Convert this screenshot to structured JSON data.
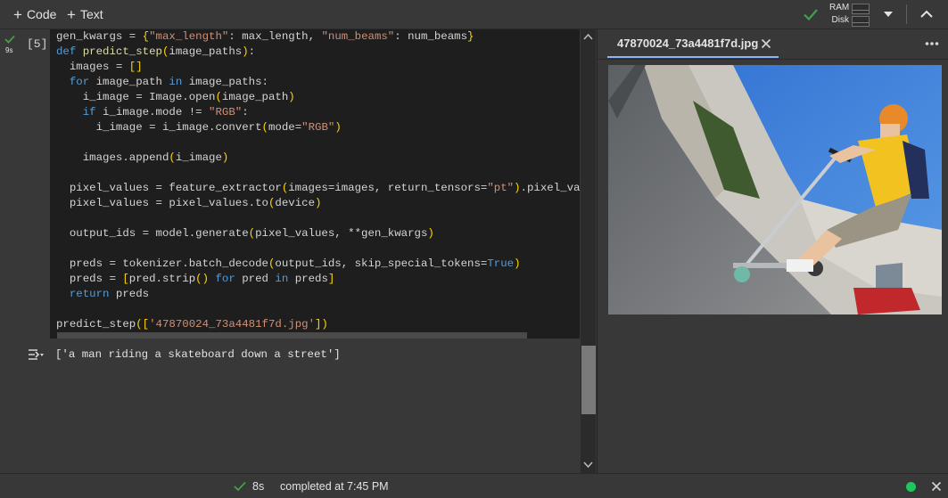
{
  "toolbar": {
    "add_code_label": "Code",
    "add_text_label": "Text",
    "ram_label": "RAM",
    "disk_label": "Disk"
  },
  "cell": {
    "execution_count": "[5]",
    "run_time": "9s",
    "output": "['a man riding a skateboard down a street']"
  },
  "image_pane": {
    "tab_title": "47870024_73a4481f7d.jpg"
  },
  "status": {
    "duration": "8s",
    "message": "completed at 7:45 PM"
  },
  "colors": {
    "success_green": "#43a047",
    "connected_dot": "#1ec85d",
    "tab_accent": "#8ab4f8"
  },
  "icons": [
    "add-icon",
    "checkmark-icon",
    "resource-meter-icon",
    "dropdown-icon",
    "collapse-icon",
    "output-icon",
    "close-icon",
    "more-icon",
    "connected-dot-icon"
  ]
}
